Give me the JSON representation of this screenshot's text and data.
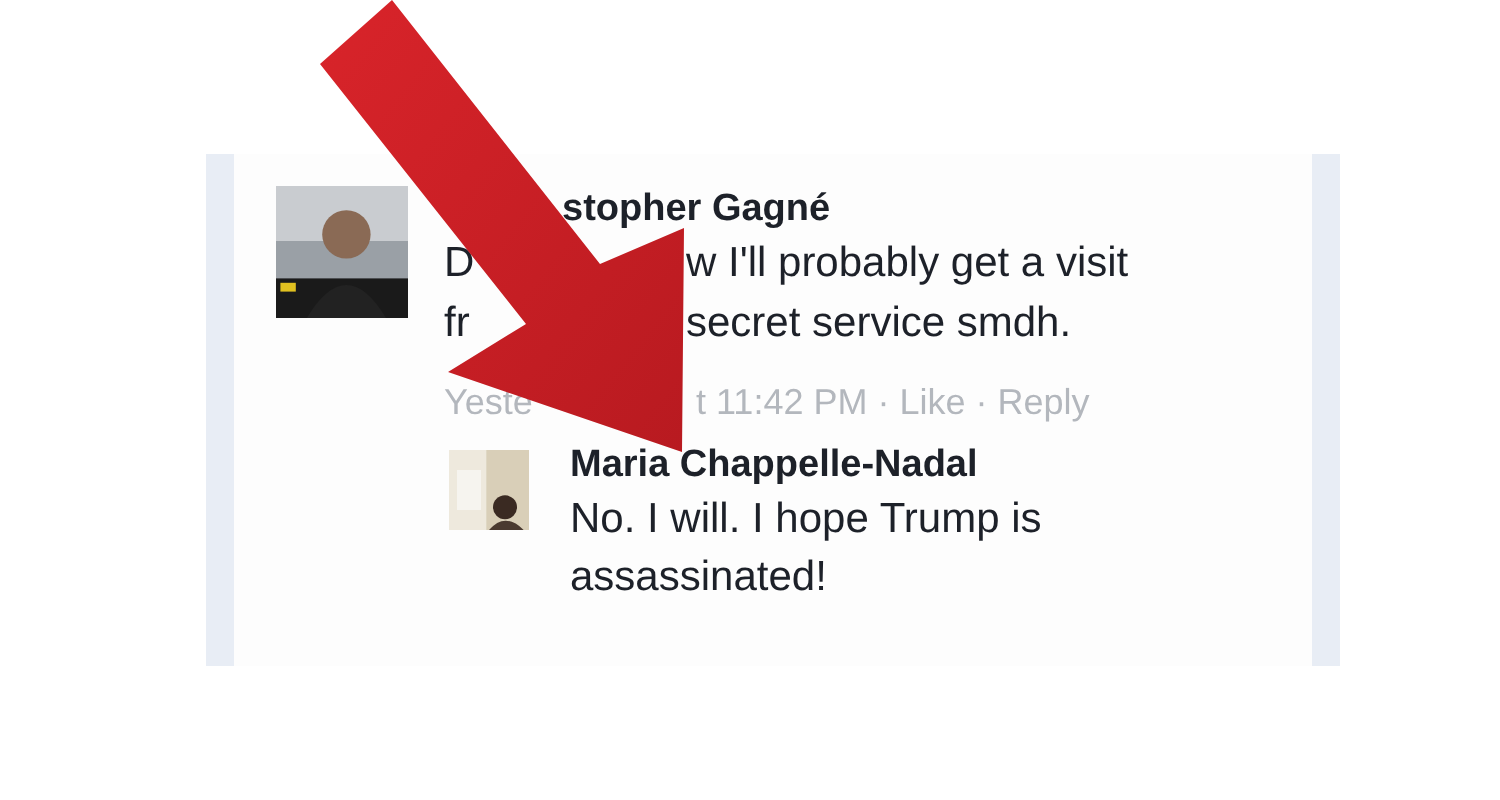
{
  "comments": [
    {
      "author": "stopher Gagné",
      "avatar": {
        "kind": "picture"
      },
      "body_lines": [
        [
          "D",
          "w I'll probably get a visit"
        ],
        [
          "fr",
          "secret service smdh."
        ]
      ],
      "meta": [
        "Yeste",
        "t 11:42 PM · Like · Reply"
      ],
      "replies": [
        {
          "author": "Maria Chappelle-Nadal",
          "avatar": {
            "kind": "picture"
          },
          "body": "No. I will. I hope Trump is assassinated!"
        }
      ]
    }
  ]
}
